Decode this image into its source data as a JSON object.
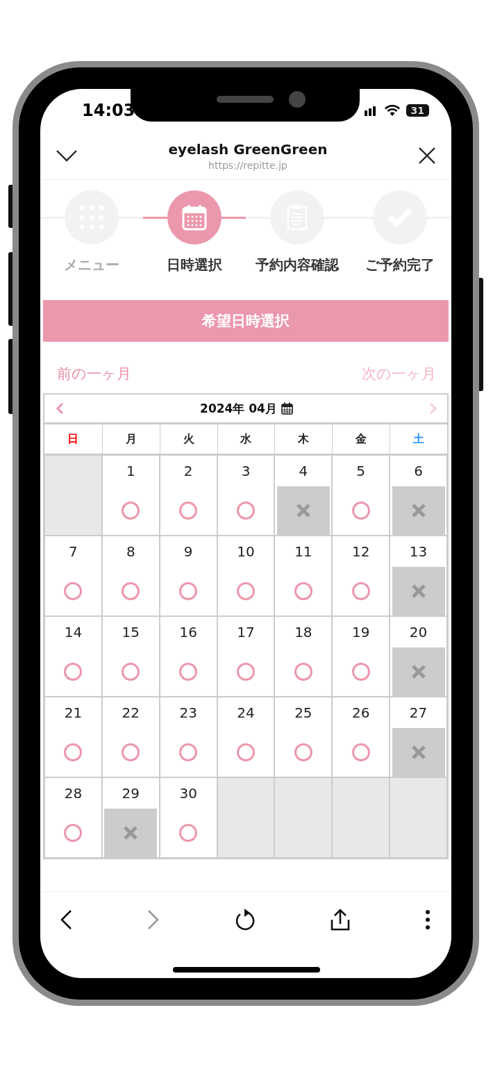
{
  "status_bar": {
    "time": "14:03",
    "battery": "31"
  },
  "header": {
    "title": "eyelash GreenGreen",
    "url": "https://repitte.jp"
  },
  "steps": [
    {
      "label": "メニュー",
      "kind": "grid",
      "selected": false,
      "completed": true
    },
    {
      "label": "日時選択",
      "kind": "calendar",
      "selected": true,
      "completed": false
    },
    {
      "label": "予約内容確認",
      "kind": "clipboard",
      "selected": false,
      "completed": false
    },
    {
      "label": "ご予約完了",
      "kind": "check",
      "selected": false,
      "completed": false
    }
  ],
  "banner": "希望日時選択",
  "month_nav": {
    "prev": {
      "label": "前の一ヶ月",
      "disabled": false
    },
    "next": {
      "label": "次の一ヶ月",
      "disabled": true
    }
  },
  "calendar": {
    "title": "2024年 04月",
    "prev_disabled": false,
    "next_disabled": true,
    "weekdays": [
      {
        "label": "日",
        "color": "#ff0000"
      },
      {
        "label": "月",
        "color": "#222222"
      },
      {
        "label": "火",
        "color": "#222222"
      },
      {
        "label": "水",
        "color": "#222222"
      },
      {
        "label": "木",
        "color": "#222222"
      },
      {
        "label": "金",
        "color": "#222222"
      },
      {
        "label": "土",
        "color": "#1e90ff"
      }
    ],
    "weeks": [
      [
        {
          "kind": "blank"
        },
        {
          "kind": "available",
          "day": "1"
        },
        {
          "kind": "available",
          "day": "2"
        },
        {
          "kind": "available",
          "day": "3"
        },
        {
          "kind": "full",
          "day": "4"
        },
        {
          "kind": "available",
          "day": "5"
        },
        {
          "kind": "full",
          "day": "6"
        }
      ],
      [
        {
          "kind": "available",
          "day": "7"
        },
        {
          "kind": "available",
          "day": "8"
        },
        {
          "kind": "available",
          "day": "9"
        },
        {
          "kind": "available",
          "day": "10"
        },
        {
          "kind": "available",
          "day": "11"
        },
        {
          "kind": "available",
          "day": "12"
        },
        {
          "kind": "full",
          "day": "13"
        }
      ],
      [
        {
          "kind": "available",
          "day": "14"
        },
        {
          "kind": "available",
          "day": "15"
        },
        {
          "kind": "available",
          "day": "16"
        },
        {
          "kind": "available",
          "day": "17"
        },
        {
          "kind": "available",
          "day": "18"
        },
        {
          "kind": "available",
          "day": "19"
        },
        {
          "kind": "full",
          "day": "20"
        }
      ],
      [
        {
          "kind": "available",
          "day": "21"
        },
        {
          "kind": "available",
          "day": "22"
        },
        {
          "kind": "available",
          "day": "23"
        },
        {
          "kind": "available",
          "day": "24"
        },
        {
          "kind": "available",
          "day": "25"
        },
        {
          "kind": "available",
          "day": "26"
        },
        {
          "kind": "full",
          "day": "27"
        }
      ],
      [
        {
          "kind": "available",
          "day": "28"
        },
        {
          "kind": "full",
          "day": "29"
        },
        {
          "kind": "available",
          "day": "30"
        },
        {
          "kind": "blank"
        },
        {
          "kind": "blank"
        },
        {
          "kind": "blank"
        },
        {
          "kind": "blank"
        }
      ]
    ]
  },
  "toolbar": [
    {
      "kind": "back",
      "disabled": false
    },
    {
      "kind": "forward",
      "disabled": true
    },
    {
      "kind": "reload",
      "disabled": false
    },
    {
      "kind": "share",
      "disabled": false
    },
    {
      "kind": "more",
      "disabled": false
    }
  ]
}
